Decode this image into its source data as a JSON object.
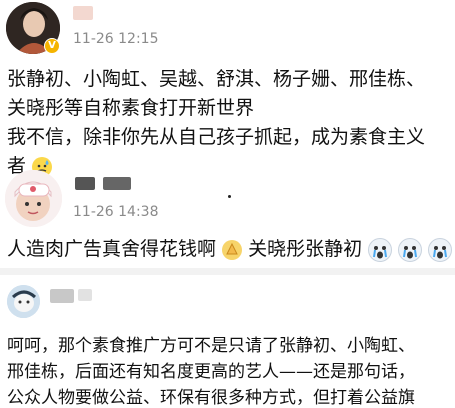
{
  "comments": [
    {
      "timestamp": "11-26 12:15",
      "lines": [
        "张静初、小陶虹、吴越、舒淇、杨子姗、邢佳栋、",
        "关晓彤等自称素食打开新世界",
        "我不信，除非你先从自己孩子抓起，成为素食主义",
        "者"
      ]
    },
    {
      "timestamp": "11-26 14:38",
      "text_a": "人造肉广告真舍得花钱啊",
      "text_b": "关晓彤张静初"
    },
    {
      "lines": [
        "呵呵，那个素食推广方可不是只请了张静初、小陶虹、",
        "邢佳栋，后面还有知名度更高的艺人——还是那句话，",
        "公众人物要做公益、环保有很多种方式，但打着公益旗"
      ]
    }
  ],
  "badges": {
    "verified": "V"
  },
  "colors": {
    "verified": "#f5b400",
    "timestamp": "#8a8a8a"
  },
  "icons": [
    "sweat-emoji-icon",
    "clapping-emoji-icon",
    "crying-emoji-icon"
  ]
}
